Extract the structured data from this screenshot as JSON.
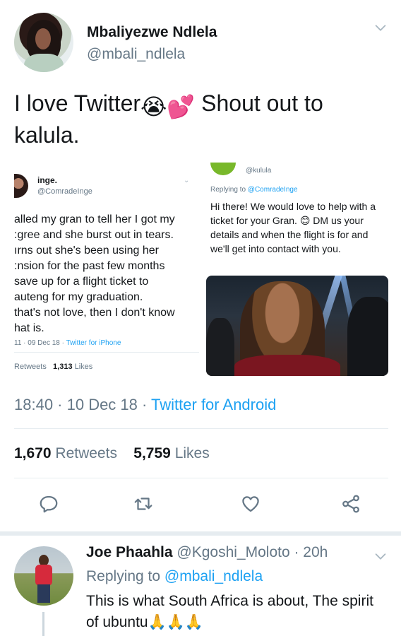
{
  "tweet": {
    "display_name": "Mbaliyezwe Ndlela",
    "handle": "@mbali_ndlela",
    "text_before": "I love Twitter",
    "emoji_1": "😭",
    "emoji_2": "💕",
    "text_after": " Shout out to kalula.",
    "timestamp_time": "18:40 · 10 Dec 18 · ",
    "timestamp_source": "Twitter for Android",
    "retweets_count": "1,670",
    "retweets_label": "Retweets",
    "likes_count": "5,759",
    "likes_label": "Likes"
  },
  "embedded_left": {
    "name": "inge.",
    "handle": "@ComradeInge",
    "text": "alled my gran to tell her I got my\n:gree and she burst out in tears.\nırns out she's been using her\n:nsion for the past few months\n save up for a flight ticket to\nauteng for my graduation.\nthat's not love, then I don't know\nhat is.",
    "meta_time": "11 · 09 Dec 18 · ",
    "meta_source": "Twitter for iPhone",
    "retweets_label": "Retweets",
    "likes_count": "1,313",
    "likes_label": "Likes"
  },
  "embedded_right": {
    "handle": "@kulula",
    "replying_prefix": "Replying to ",
    "replying_handle": "@ComradeInge",
    "text": "Hi there! We would love to help with a ticket for your Gran. 😊 DM us your details and when the flight is for and we'll get into contact with you."
  },
  "reply": {
    "name": "Joe Phaahla",
    "handle_time": " @Kgoshi_Moloto · 20h",
    "replying_prefix": "Replying to ",
    "replying_handle": "@mbali_ndlela",
    "text": "This is what South Africa is about, The spirit of ubuntu🙏🙏🙏"
  },
  "icons": {
    "menu": "chevron-down-icon",
    "reply": "reply-icon",
    "retweet": "retweet-icon",
    "like": "heart-icon",
    "share": "share-icon"
  },
  "colors": {
    "link": "#1da1f2",
    "secondary_text": "#657786",
    "primary_text": "#14171a",
    "divider": "#e6ecf0"
  }
}
